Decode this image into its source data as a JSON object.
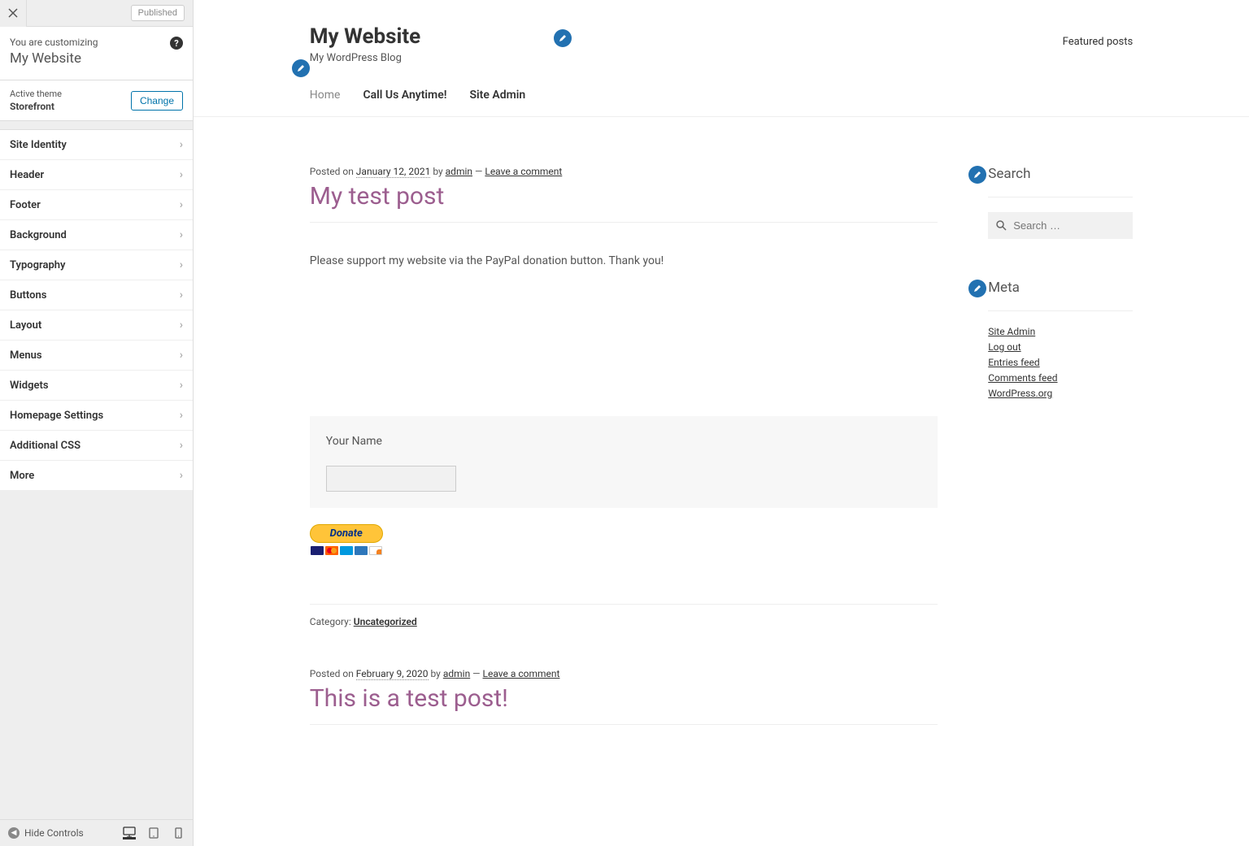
{
  "sidebar": {
    "publish_label": "Published",
    "customizing_label": "You are customizing",
    "site_name": "My Website",
    "active_theme_label": "Active theme",
    "theme_name": "Storefront",
    "change_label": "Change",
    "panels": [
      "Site Identity",
      "Header",
      "Footer",
      "Background",
      "Typography",
      "Buttons",
      "Layout",
      "Menus",
      "Widgets",
      "Homepage Settings",
      "Additional CSS",
      "More"
    ],
    "hide_controls": "Hide Controls"
  },
  "preview": {
    "site_title": "My Website",
    "tagline": "My WordPress Blog",
    "featured_link": "Featured posts",
    "nav": [
      "Home",
      "Call Us Anytime!",
      "Site Admin"
    ],
    "post1": {
      "posted_on": "Posted on ",
      "date": "January 12, 2021",
      "by": " by ",
      "author": "admin",
      "dash": " — ",
      "leave_comment": "Leave a comment",
      "title": "My test post",
      "body": "Please support my website via the PayPal donation button. Thank you!",
      "form_label": "Your Name",
      "donate_label": "Donate",
      "category_label": "Category: ",
      "category": "Uncategorized"
    },
    "post2": {
      "posted_on": "Posted on ",
      "date": "February 9, 2020",
      "by": " by ",
      "author": "admin",
      "dash": " — ",
      "leave_comment": "Leave a comment",
      "title": "This is a test post!"
    },
    "widgets": {
      "search_title": "Search",
      "search_placeholder": "Search …",
      "meta_title": "Meta",
      "meta_links": [
        "Site Admin",
        "Log out",
        "Entries feed",
        "Comments feed",
        "WordPress.org"
      ]
    }
  }
}
